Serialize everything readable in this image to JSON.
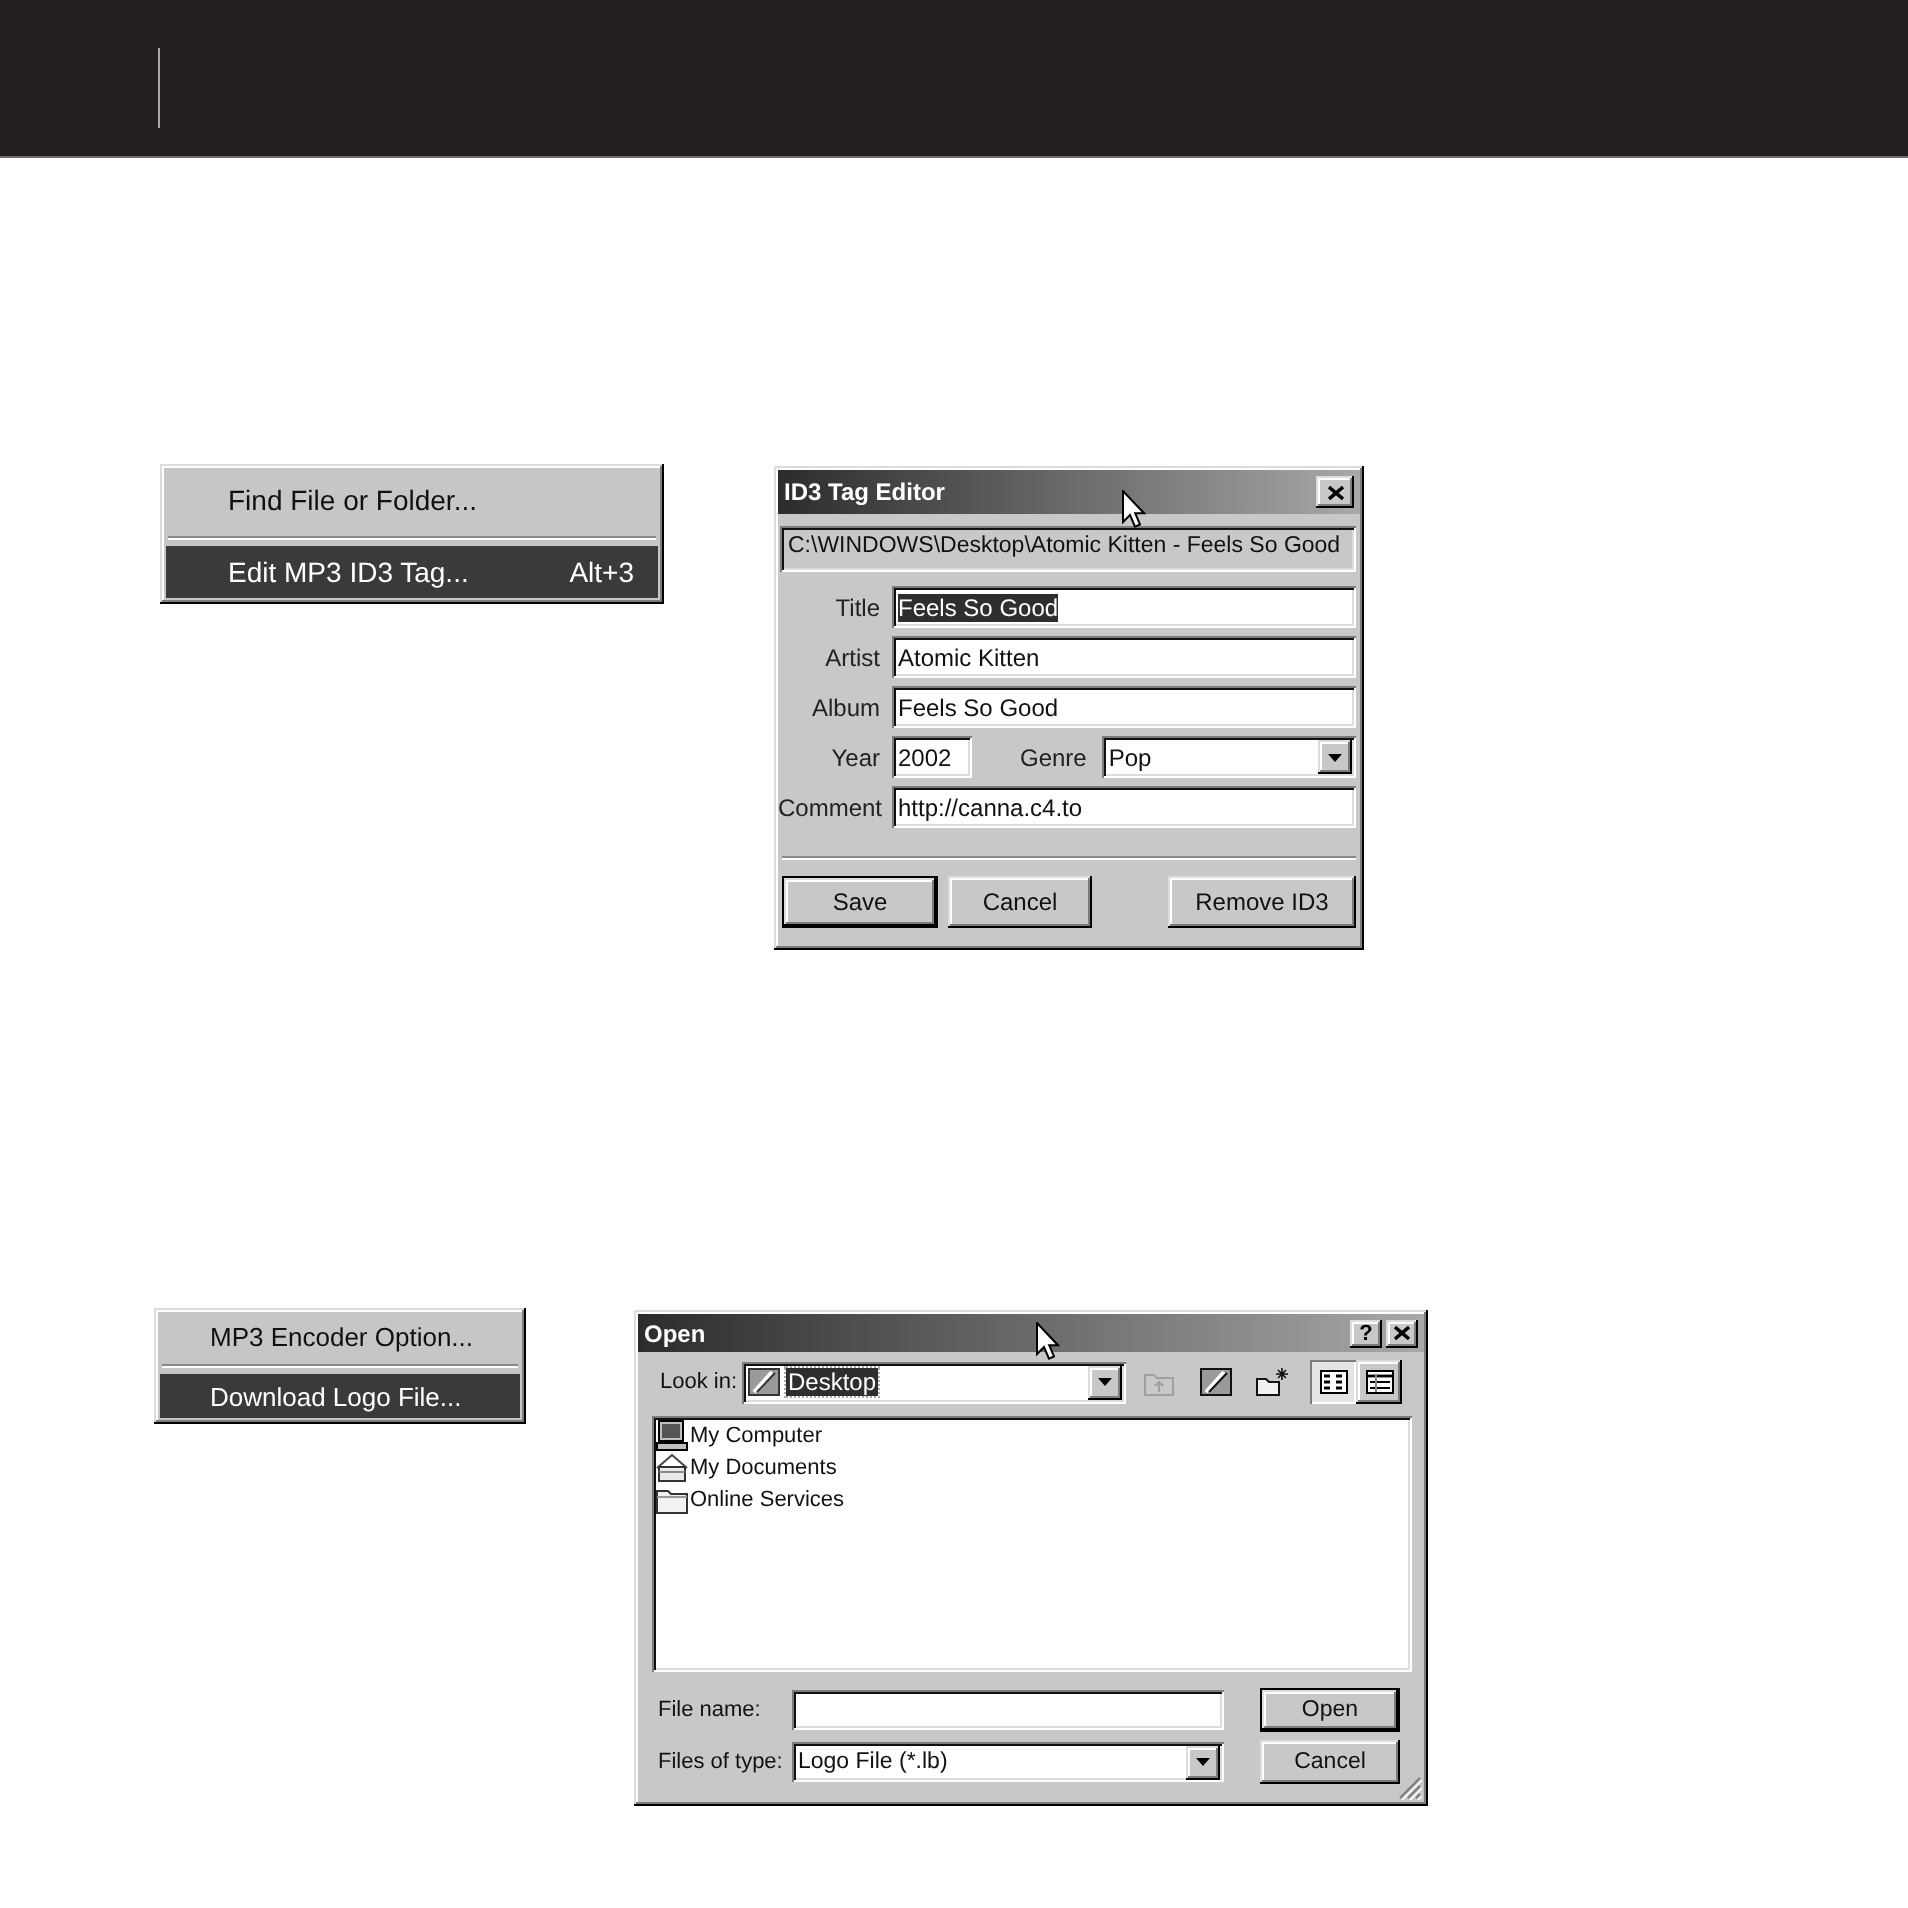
{
  "context_menu_1": {
    "items": [
      {
        "label": "Find File or Folder...",
        "selected": false,
        "separator_after": true
      },
      {
        "label": "Edit MP3 ID3 Tag...",
        "shortcut": "Alt+3",
        "selected": true,
        "separator_after": false
      }
    ]
  },
  "id3_tag_editor": {
    "title": "ID3 Tag Editor",
    "path": "C:\\WINDOWS\\Desktop\\Atomic Kitten - Feels So Good",
    "rows": [
      {
        "fields": [
          {
            "kind": "text",
            "label": "Title",
            "value": "Feels So Good",
            "highlighted": true
          }
        ]
      },
      {
        "fields": [
          {
            "kind": "text",
            "label": "Artist",
            "value": "Atomic Kitten",
            "highlighted": false
          }
        ]
      },
      {
        "fields": [
          {
            "kind": "text",
            "label": "Album",
            "value": "Feels So Good",
            "highlighted": false
          }
        ]
      },
      {
        "fields": [
          {
            "kind": "text",
            "label": "Year",
            "value": "2002",
            "highlighted": false
          },
          {
            "kind": "dropdown",
            "label": "Genre",
            "value": "Pop",
            "highlighted": false
          }
        ]
      },
      {
        "fields": [
          {
            "kind": "text",
            "label": "Comment",
            "value": "http://canna.c4.to",
            "highlighted": false
          }
        ]
      }
    ],
    "buttons": [
      {
        "label": "Save",
        "default": true
      },
      {
        "label": "Cancel",
        "default": false
      },
      {
        "label": "Remove ID3",
        "default": false
      }
    ]
  },
  "context_menu_2": {
    "items": [
      {
        "label": "MP3 Encoder Option...",
        "selected": false,
        "separator_after": true
      },
      {
        "label": "Download Logo File...",
        "selected": true,
        "separator_after": false
      }
    ]
  },
  "open_dialog": {
    "title": "Open",
    "help_button": "?",
    "look_in": {
      "label": "Look in:",
      "value": "Desktop",
      "highlighted": true
    },
    "toolbar_buttons": [
      {
        "disabled": true
      },
      {
        "disabled": false
      },
      {
        "disabled": false
      }
    ],
    "view_buttons": [
      {
        "selected": true
      },
      {
        "selected": false
      }
    ],
    "files": [
      {
        "kind": "computer",
        "label": "My Computer",
        "selected": false
      },
      {
        "kind": "documents",
        "label": "My Documents",
        "selected": false
      },
      {
        "kind": "folder",
        "label": "Online Services",
        "selected": false
      }
    ],
    "file_name": {
      "label": "File name:"
    },
    "file_type": {
      "label": "Files of type:",
      "value": "Logo File (*.lb)"
    },
    "buttons": [
      {
        "label": "Open",
        "default": true
      },
      {
        "label": "Cancel",
        "default": false
      }
    ]
  }
}
